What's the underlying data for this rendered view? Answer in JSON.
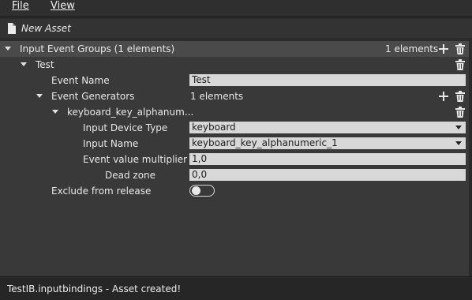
{
  "menu": {
    "file": "File",
    "view": "View"
  },
  "toolbar": {
    "new_asset_label": "New Asset",
    "new_asset_icon": "document-icon"
  },
  "tree": {
    "group_header_label": "Input Event Groups (1 elements)",
    "group_header_count": "1 elements",
    "test_label": "Test",
    "event_name_label": "Event Name",
    "event_name_value": "Test",
    "event_generators_label": "Event Generators",
    "event_generators_count": "1 elements",
    "generator_label": "keyboard_key_alphanum...",
    "input_device_type_label": "Input Device Type",
    "input_device_type_value": "keyboard",
    "input_name_label": "Input Name",
    "input_name_value": "keyboard_key_alphanumeric_1",
    "event_value_multiplier_label": "Event value multiplier",
    "event_value_multiplier_value": "1,0",
    "dead_zone_label": "Dead zone",
    "dead_zone_value": "0,0",
    "exclude_from_release_label": "Exclude from release",
    "exclude_from_release_on": false
  },
  "status": {
    "message": "TestIB.inputbindings - Asset created!"
  },
  "colors": {
    "panel_bg": "#393939",
    "header_bg": "#4a4a4a",
    "field_bg": "#d8d8d8"
  }
}
